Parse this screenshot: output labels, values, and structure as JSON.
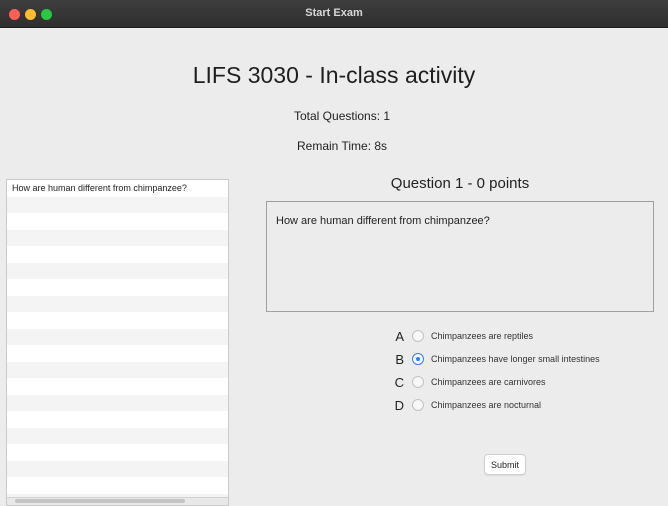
{
  "window": {
    "title": "Start Exam"
  },
  "exam": {
    "title": "LIFS 3030 - In-class activity",
    "total_questions": "Total Questions: 1",
    "remain_time": "Remain Time:  8s"
  },
  "question_list": {
    "items": [
      "How are human different from chimpanzee?"
    ],
    "empty_rows": 19
  },
  "question": {
    "heading": "Question  1 - 0 points",
    "text": "How are human different from chimpanzee?",
    "options": [
      {
        "letter": "A",
        "text": "Chimpanzees are reptiles",
        "selected": false
      },
      {
        "letter": "B",
        "text": "Chimpanzees have longer small intestines",
        "selected": true
      },
      {
        "letter": "C",
        "text": "Chimpanzees are carnivores",
        "selected": false
      },
      {
        "letter": "D",
        "text": "Chimpanzees are nocturnal",
        "selected": false
      }
    ]
  },
  "actions": {
    "submit_label": "Submit"
  },
  "colors": {
    "accent": "#2f7df6",
    "window_background": "#ececec",
    "titlebar": "#2e2e2e",
    "close": "#ff5f57",
    "minimize": "#febc2e",
    "maximize": "#28c840"
  }
}
